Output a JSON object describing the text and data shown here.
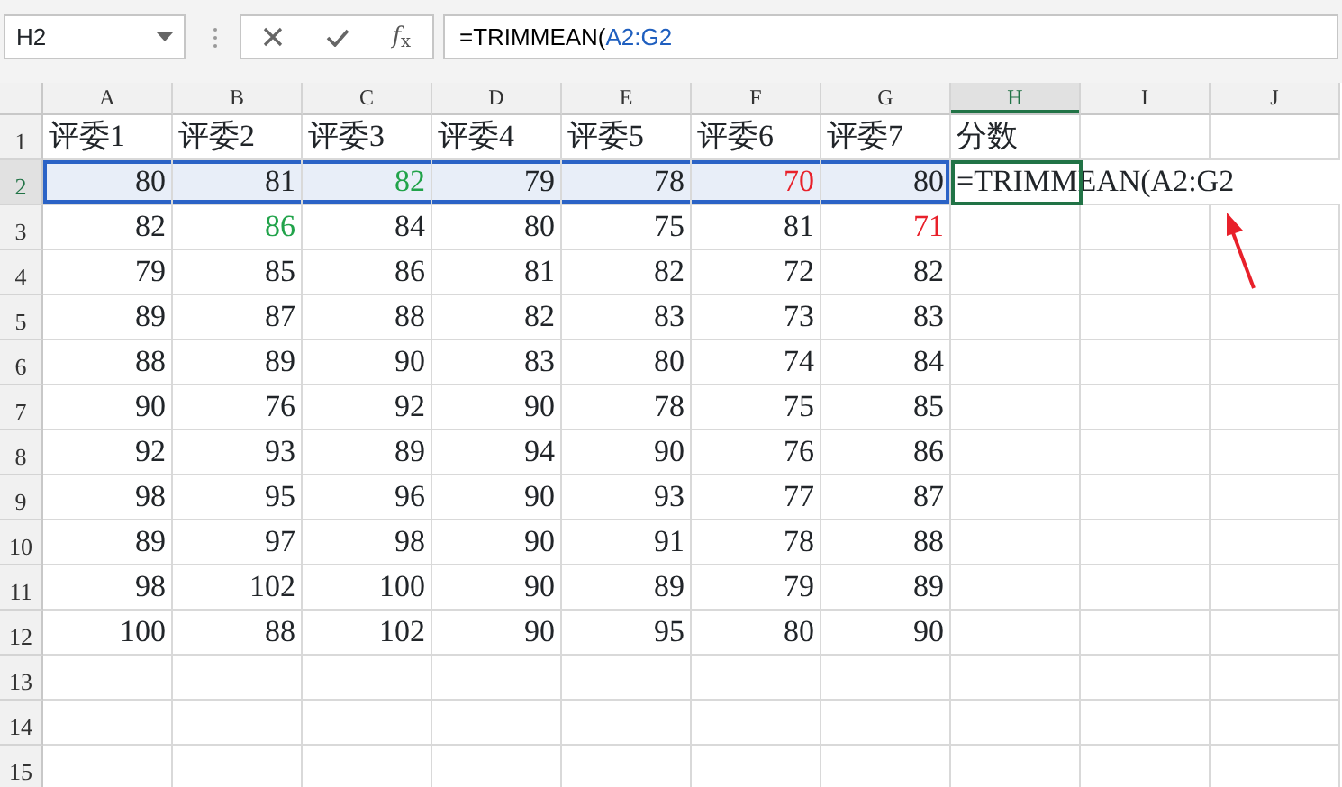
{
  "name_box": {
    "value": "H2"
  },
  "formula_bar": {
    "function_label": "*f*$_{x}$",
    "parts": [
      {
        "text": "=TRIMMEAN(",
        "color": "#000000"
      },
      {
        "text": "A2:G2",
        "color": "#1f5fbf"
      }
    ]
  },
  "sheet": {
    "columns": [
      {
        "label": "A",
        "selected": false
      },
      {
        "label": "B",
        "selected": false
      },
      {
        "label": "C",
        "selected": false
      },
      {
        "label": "D",
        "selected": false
      },
      {
        "label": "E",
        "selected": false
      },
      {
        "label": "F",
        "selected": false
      },
      {
        "label": "G",
        "selected": false
      },
      {
        "label": "H",
        "selected": true
      },
      {
        "label": "I",
        "selected": false
      },
      {
        "label": "J",
        "selected": false
      }
    ],
    "rows": [
      {
        "number": "1",
        "selected": false,
        "cells": [
          {
            "value": "评委1",
            "kind": "text"
          },
          {
            "value": "评委2",
            "kind": "text"
          },
          {
            "value": "评委3",
            "kind": "text"
          },
          {
            "value": "评委4",
            "kind": "text"
          },
          {
            "value": "评委5",
            "kind": "text"
          },
          {
            "value": "评委6",
            "kind": "text"
          },
          {
            "value": "评委7",
            "kind": "text"
          },
          {
            "value": "分数",
            "kind": "text"
          }
        ]
      },
      {
        "number": "2",
        "selected": true,
        "cells": [
          {
            "value": "80",
            "kind": "number"
          },
          {
            "value": "81",
            "kind": "number"
          },
          {
            "value": "82",
            "kind": "number",
            "color": "#21a34a"
          },
          {
            "value": "79",
            "kind": "number"
          },
          {
            "value": "78",
            "kind": "number"
          },
          {
            "value": "70",
            "kind": "number",
            "color": "#e8202a"
          },
          {
            "value": "80",
            "kind": "number"
          },
          {
            "value": "=TRIMMEAN(A2:G2",
            "kind": "formula",
            "active": true
          }
        ]
      },
      {
        "number": "3",
        "selected": false,
        "cells": [
          {
            "value": "82",
            "kind": "number"
          },
          {
            "value": "86",
            "kind": "number",
            "color": "#21a34a"
          },
          {
            "value": "84",
            "kind": "number"
          },
          {
            "value": "80",
            "kind": "number"
          },
          {
            "value": "75",
            "kind": "number"
          },
          {
            "value": "81",
            "kind": "number"
          },
          {
            "value": "71",
            "kind": "number",
            "color": "#e8202a"
          }
        ]
      },
      {
        "number": "4",
        "selected": false,
        "cells": [
          {
            "value": "79",
            "kind": "number"
          },
          {
            "value": "85",
            "kind": "number"
          },
          {
            "value": "86",
            "kind": "number"
          },
          {
            "value": "81",
            "kind": "number"
          },
          {
            "value": "82",
            "kind": "number"
          },
          {
            "value": "72",
            "kind": "number"
          },
          {
            "value": "82",
            "kind": "number"
          }
        ]
      },
      {
        "number": "5",
        "selected": false,
        "cells": [
          {
            "value": "89",
            "kind": "number"
          },
          {
            "value": "87",
            "kind": "number"
          },
          {
            "value": "88",
            "kind": "number"
          },
          {
            "value": "82",
            "kind": "number"
          },
          {
            "value": "83",
            "kind": "number"
          },
          {
            "value": "73",
            "kind": "number"
          },
          {
            "value": "83",
            "kind": "number"
          }
        ]
      },
      {
        "number": "6",
        "selected": false,
        "cells": [
          {
            "value": "88",
            "kind": "number"
          },
          {
            "value": "89",
            "kind": "number"
          },
          {
            "value": "90",
            "kind": "number"
          },
          {
            "value": "83",
            "kind": "number"
          },
          {
            "value": "80",
            "kind": "number"
          },
          {
            "value": "74",
            "kind": "number"
          },
          {
            "value": "84",
            "kind": "number"
          }
        ]
      },
      {
        "number": "7",
        "selected": false,
        "cells": [
          {
            "value": "90",
            "kind": "number"
          },
          {
            "value": "76",
            "kind": "number"
          },
          {
            "value": "92",
            "kind": "number"
          },
          {
            "value": "90",
            "kind": "number"
          },
          {
            "value": "78",
            "kind": "number"
          },
          {
            "value": "75",
            "kind": "number"
          },
          {
            "value": "85",
            "kind": "number"
          }
        ]
      },
      {
        "number": "8",
        "selected": false,
        "cells": [
          {
            "value": "92",
            "kind": "number"
          },
          {
            "value": "93",
            "kind": "number"
          },
          {
            "value": "89",
            "kind": "number"
          },
          {
            "value": "94",
            "kind": "number"
          },
          {
            "value": "90",
            "kind": "number"
          },
          {
            "value": "76",
            "kind": "number"
          },
          {
            "value": "86",
            "kind": "number"
          }
        ]
      },
      {
        "number": "9",
        "selected": false,
        "cells": [
          {
            "value": "98",
            "kind": "number"
          },
          {
            "value": "95",
            "kind": "number"
          },
          {
            "value": "96",
            "kind": "number"
          },
          {
            "value": "90",
            "kind": "number"
          },
          {
            "value": "93",
            "kind": "number"
          },
          {
            "value": "77",
            "kind": "number"
          },
          {
            "value": "87",
            "kind": "number"
          }
        ]
      },
      {
        "number": "10",
        "selected": false,
        "cells": [
          {
            "value": "89",
            "kind": "number"
          },
          {
            "value": "97",
            "kind": "number"
          },
          {
            "value": "98",
            "kind": "number"
          },
          {
            "value": "90",
            "kind": "number"
          },
          {
            "value": "91",
            "kind": "number"
          },
          {
            "value": "78",
            "kind": "number"
          },
          {
            "value": "88",
            "kind": "number"
          }
        ]
      },
      {
        "number": "11",
        "selected": false,
        "cells": [
          {
            "value": "98",
            "kind": "number"
          },
          {
            "value": "102",
            "kind": "number"
          },
          {
            "value": "100",
            "kind": "number"
          },
          {
            "value": "90",
            "kind": "number"
          },
          {
            "value": "89",
            "kind": "number"
          },
          {
            "value": "79",
            "kind": "number"
          },
          {
            "value": "89",
            "kind": "number"
          }
        ]
      },
      {
        "number": "12",
        "selected": false,
        "cells": [
          {
            "value": "100",
            "kind": "number"
          },
          {
            "value": "88",
            "kind": "number"
          },
          {
            "value": "102",
            "kind": "number"
          },
          {
            "value": "90",
            "kind": "number"
          },
          {
            "value": "95",
            "kind": "number"
          },
          {
            "value": "80",
            "kind": "number"
          },
          {
            "value": "90",
            "kind": "number"
          }
        ]
      },
      {
        "number": "13",
        "selected": false,
        "cells": []
      },
      {
        "number": "14",
        "selected": false,
        "cells": []
      },
      {
        "number": "15",
        "selected": false,
        "cells": []
      }
    ]
  }
}
